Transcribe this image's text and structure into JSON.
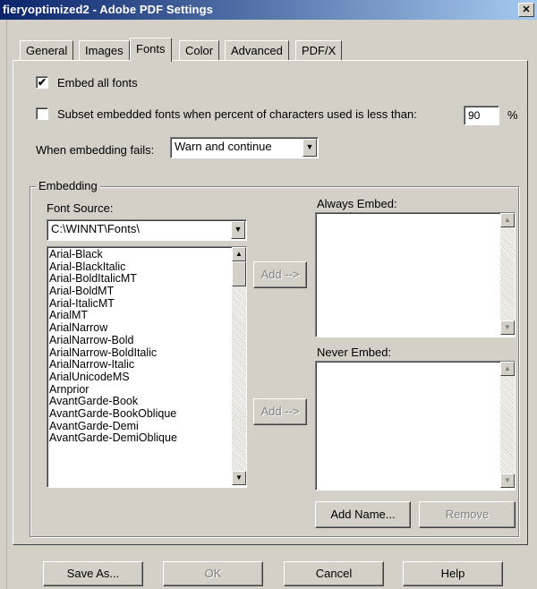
{
  "window": {
    "title": "fieryoptimized2 - Adobe PDF Settings",
    "close_glyph": "✕"
  },
  "tabs": [
    {
      "label": "General",
      "active": false
    },
    {
      "label": "Images",
      "active": false
    },
    {
      "label": "Fonts",
      "active": true
    },
    {
      "label": "Color",
      "active": false
    },
    {
      "label": "Advanced",
      "active": false
    },
    {
      "label": "PDF/X",
      "active": false
    }
  ],
  "fonts": {
    "embed_all": {
      "label": "Embed all fonts",
      "checked": true,
      "check_glyph": "✔"
    },
    "subset": {
      "label": "Subset embedded fonts when percent of characters used is less than:",
      "checked": false,
      "value": "90",
      "unit": "%"
    },
    "when_fails": {
      "label": "When embedding fails:",
      "value": "Warn and continue"
    },
    "embedding": {
      "group_title": "Embedding",
      "font_source_label": "Font Source:",
      "font_source_value": "C:\\WINNT\\Fonts\\",
      "font_list": [
        "Arial-Black",
        "Arial-BlackItalic",
        "Arial-BoldItalicMT",
        "Arial-BoldMT",
        "Arial-ItalicMT",
        "ArialMT",
        "ArialNarrow",
        "ArialNarrow-Bold",
        "ArialNarrow-BoldItalic",
        "ArialNarrow-Italic",
        "ArialUnicodeMS",
        "Arnprior",
        "AvantGarde-Book",
        "AvantGarde-BookOblique",
        "AvantGarde-Demi",
        "AvantGarde-DemiOblique"
      ],
      "add_always_label": "Add -->",
      "add_never_label": "Add -->",
      "always_embed_label": "Always Embed:",
      "never_embed_label": "Never Embed:",
      "add_name_label": "Add Name...",
      "remove_label": "Remove"
    }
  },
  "footer": {
    "save_as": "Save As...",
    "ok": "OK",
    "cancel": "Cancel",
    "help": "Help"
  },
  "icons": {
    "dropdown_arrow": "▼",
    "scroll_up": "▲",
    "scroll_down": "▼"
  }
}
